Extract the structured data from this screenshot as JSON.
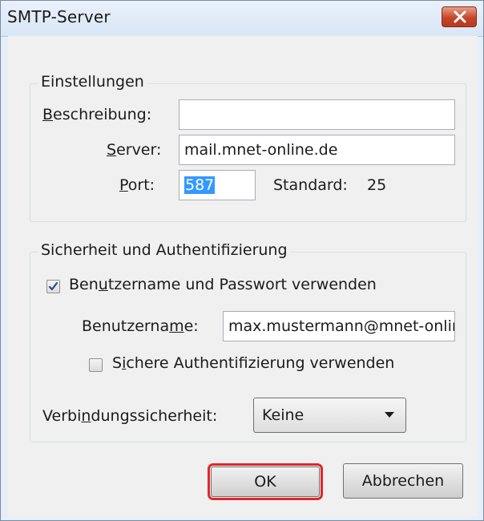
{
  "window": {
    "title": "SMTP-Server"
  },
  "settings": {
    "legend": "Einstellungen",
    "description_label_u": "B",
    "description_label_rest": "eschreibung:",
    "description_value": "",
    "server_label_u": "S",
    "server_label_rest": "erver:",
    "server_value": "mail.mnet-online.de",
    "port_label_u": "P",
    "port_label_rest": "ort:",
    "port_value": "587",
    "default_label": "Standard:",
    "default_value": "25"
  },
  "security": {
    "legend": "Sicherheit und Authentifizierung",
    "use_credentials_pre": "Ben",
    "use_credentials_u": "u",
    "use_credentials_post": "tzername und Passwort verwenden",
    "use_credentials_checked": true,
    "username_label_pre": "Benutzerna",
    "username_label_u": "m",
    "username_label_post": "e:",
    "username_value": "max.mustermann@mnet-online.de",
    "secure_auth_pre": "S",
    "secure_auth_u": "i",
    "secure_auth_post": "chere Authentifizierung verwenden",
    "secure_auth_checked": false,
    "connection_label_pre": "Verbi",
    "connection_label_u": "n",
    "connection_label_post": "dungssicherheit:",
    "connection_value": "Keine"
  },
  "buttons": {
    "ok": "OK",
    "cancel": "Abbrechen"
  },
  "colors": {
    "highlight": "#e0262c",
    "selection": "#3399ff",
    "close": "#c6452a"
  }
}
